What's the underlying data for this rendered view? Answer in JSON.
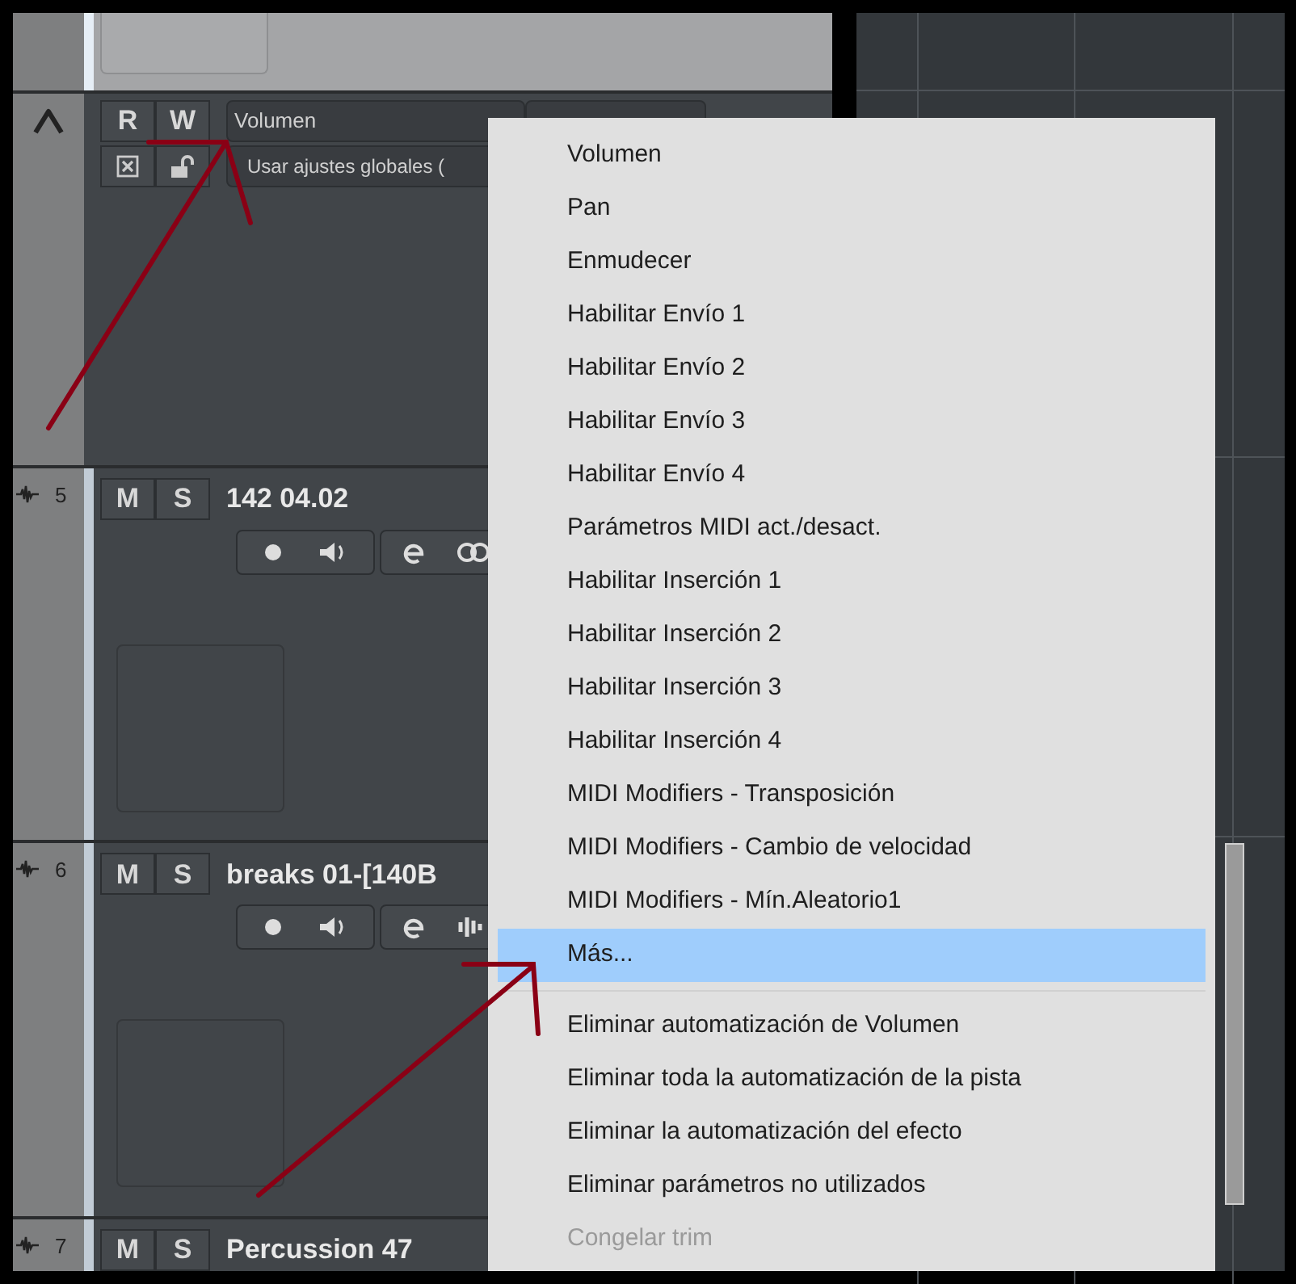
{
  "tracks": [
    {
      "kind": "stub",
      "selected": true
    },
    {
      "kind": "automation",
      "read_label": "R",
      "write_label": "W",
      "parameter": "Volumen",
      "mode": "Usar ajustes globales ("
    },
    {
      "kind": "audio",
      "selected": false,
      "number": "5",
      "mute_label": "M",
      "solo_label": "S",
      "name": "142 04.02"
    },
    {
      "kind": "audio",
      "selected": false,
      "number": "6",
      "mute_label": "M",
      "solo_label": "S",
      "name": "breaks 01-[140B"
    },
    {
      "kind": "header",
      "selected": false,
      "number": "7",
      "mute_label": "M",
      "solo_label": "S",
      "name": "Percussion 47"
    }
  ],
  "menu": {
    "groups": [
      [
        {
          "label": "Volumen",
          "selected": false,
          "disabled": false
        },
        {
          "label": "Pan",
          "selected": false,
          "disabled": false
        },
        {
          "label": "Enmudecer",
          "selected": false,
          "disabled": false
        },
        {
          "label": "Habilitar Envío 1",
          "selected": false,
          "disabled": false
        },
        {
          "label": "Habilitar Envío 2",
          "selected": false,
          "disabled": false
        },
        {
          "label": "Habilitar Envío 3",
          "selected": false,
          "disabled": false
        },
        {
          "label": "Habilitar Envío 4",
          "selected": false,
          "disabled": false
        },
        {
          "label": "Parámetros MIDI act./desact.",
          "selected": false,
          "disabled": false
        },
        {
          "label": "Habilitar Inserción 1",
          "selected": false,
          "disabled": false
        },
        {
          "label": "Habilitar Inserción 2",
          "selected": false,
          "disabled": false
        },
        {
          "label": "Habilitar Inserción 3",
          "selected": false,
          "disabled": false
        },
        {
          "label": "Habilitar Inserción 4",
          "selected": false,
          "disabled": false
        },
        {
          "label": "MIDI Modifiers - Transposición",
          "selected": false,
          "disabled": false
        },
        {
          "label": "MIDI Modifiers - Cambio de velocidad",
          "selected": false,
          "disabled": false
        },
        {
          "label": "MIDI Modifiers - Mín.Aleatorio1",
          "selected": false,
          "disabled": false
        },
        {
          "label": "Más...",
          "selected": true,
          "disabled": false
        }
      ],
      [
        {
          "label": "Eliminar automatización de Volumen",
          "selected": false,
          "disabled": false
        },
        {
          "label": "Eliminar toda la automatización de la pista",
          "selected": false,
          "disabled": false
        },
        {
          "label": "Eliminar la automatización del efecto",
          "selected": false,
          "disabled": false
        },
        {
          "label": "Eliminar parámetros no utilizados",
          "selected": false,
          "disabled": false
        },
        {
          "label": "Congelar trim",
          "selected": false,
          "disabled": true
        }
      ]
    ]
  }
}
